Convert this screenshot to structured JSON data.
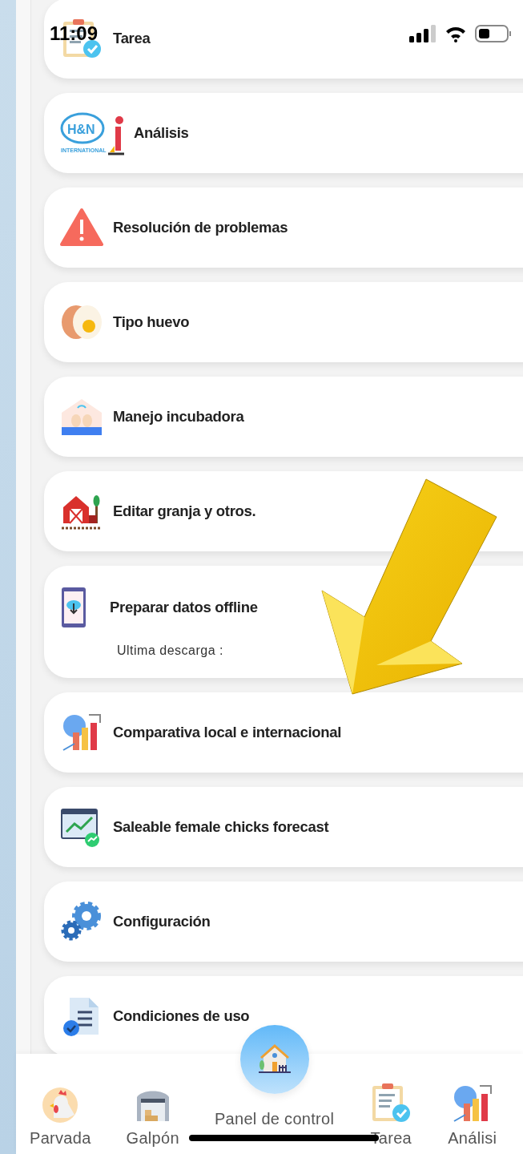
{
  "status_bar": {
    "time": "11:09"
  },
  "menu": [
    {
      "title": "Tarea"
    },
    {
      "title": "Análisis",
      "logo_text": "H&N",
      "logo_subtext": "INTERNATIONAL"
    },
    {
      "title": "Resolución de problemas"
    },
    {
      "title": "Tipo huevo"
    },
    {
      "title": "Manejo incubadora"
    },
    {
      "title": "Editar granja y otros."
    },
    {
      "title": "Preparar datos offline",
      "subtitle": "Ultima descarga :"
    },
    {
      "title": "Comparativa local e internacional"
    },
    {
      "title": "Saleable female chicks forecast"
    },
    {
      "title": "Configuración"
    },
    {
      "title": "Condiciones de uso"
    }
  ],
  "bottom_nav": [
    {
      "label": "Parvada",
      "kind": "tab"
    },
    {
      "label": "Galpón",
      "kind": "tab"
    },
    {
      "label": "Panel de control",
      "kind": "center"
    },
    {
      "label": "Tarea",
      "kind": "tab"
    },
    {
      "label": "Análisi",
      "kind": "tab"
    }
  ]
}
